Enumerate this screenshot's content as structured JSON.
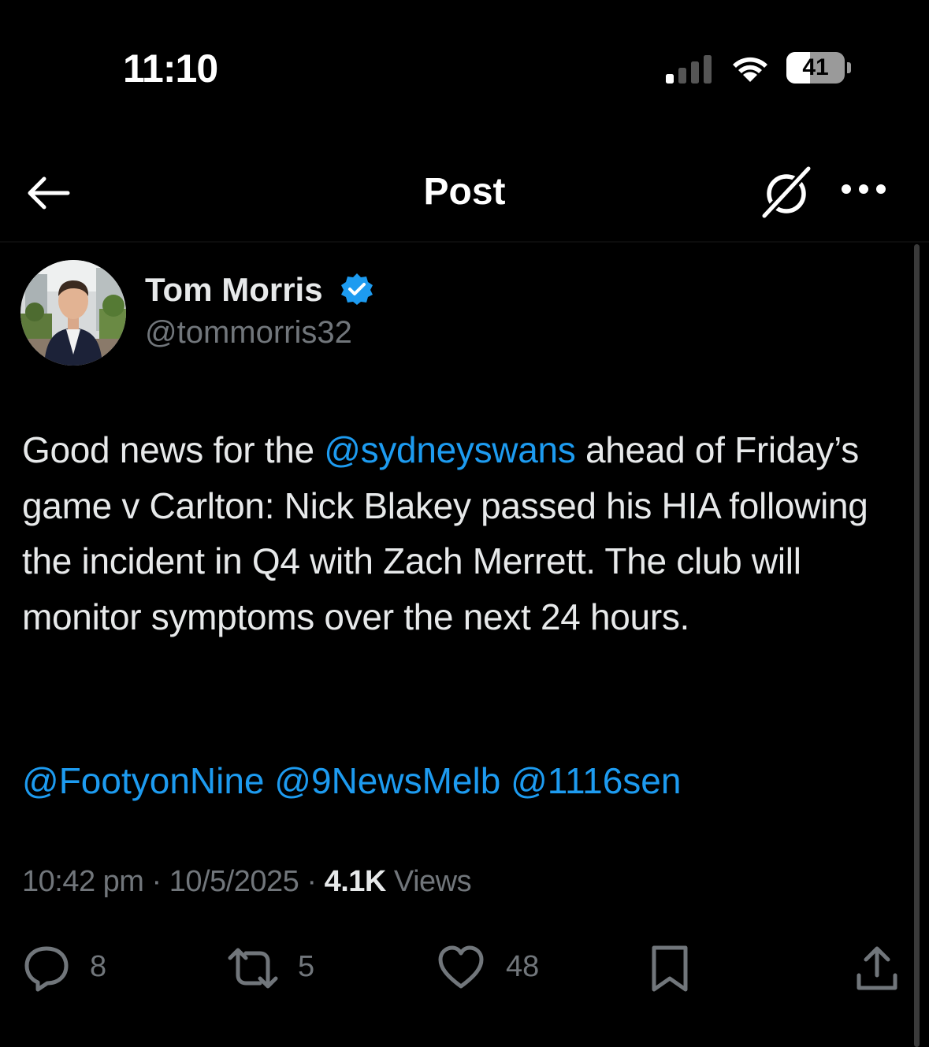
{
  "status_bar": {
    "time": "11:10",
    "battery_level": "41",
    "battery_fraction": 0.41
  },
  "header": {
    "title": "Post",
    "back_icon": "arrow-left-icon",
    "grok_icon": "grok-icon",
    "more_icon": "more-horizontal-icon"
  },
  "post": {
    "author": {
      "name": "Tom Morris",
      "handle": "@tommorris32",
      "verified": true,
      "verified_color": "#1d9bf0"
    },
    "body": {
      "part1": "Good news for the ",
      "mention1": "@sydneyswans",
      "part2": " ahead of Friday’s game v Carlton: Nick Blakey passed his HIA following the incident in Q4 with Zach Merrett. The club will monitor symptoms over the next 24 hours."
    },
    "mentions": [
      "@FootyonNine",
      "@9NewsMelb",
      "@1116sen"
    ],
    "meta": {
      "time": "10:42 pm",
      "separator": "·",
      "date": "10/5/2025",
      "views_count": "4.1K",
      "views_label": "Views"
    },
    "actions": {
      "replies": "8",
      "reposts": "5",
      "likes": "48"
    }
  },
  "colors": {
    "background": "#000000",
    "text": "#e7e9ea",
    "secondary_text": "#71767b",
    "link": "#1d9bf0"
  }
}
